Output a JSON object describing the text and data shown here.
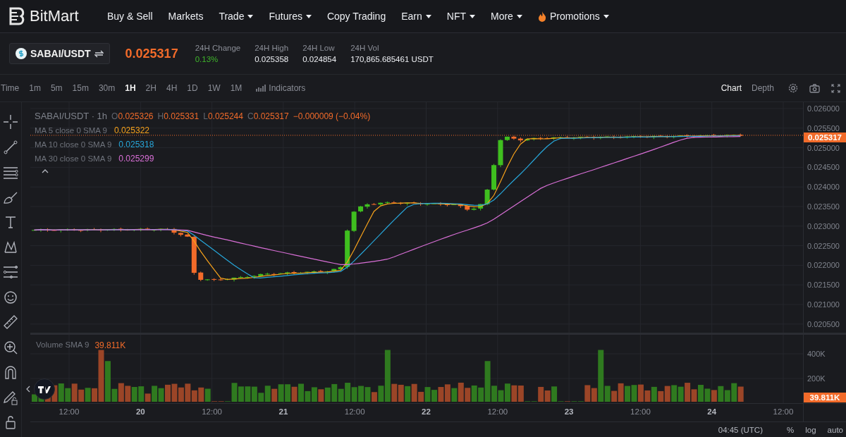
{
  "nav": {
    "brand": "BitMart",
    "items": [
      {
        "label": "Buy & Sell",
        "has_menu": false,
        "kind": "link"
      },
      {
        "label": "Markets",
        "has_menu": false,
        "kind": "link"
      },
      {
        "label": "Trade",
        "has_menu": true,
        "kind": "link"
      },
      {
        "label": "Futures",
        "has_menu": true,
        "kind": "link"
      },
      {
        "label": "Copy Trading",
        "has_menu": false,
        "kind": "link"
      },
      {
        "label": "Earn",
        "has_menu": true,
        "kind": "link"
      },
      {
        "label": "NFT",
        "has_menu": true,
        "kind": "link"
      },
      {
        "label": "More",
        "has_menu": true,
        "kind": "link"
      },
      {
        "label": "Promotions",
        "has_menu": true,
        "kind": "promo"
      }
    ]
  },
  "ticker": {
    "pair": "SABAI/USDT",
    "price": "0.025317",
    "stats": [
      {
        "label": "24H Change",
        "value": "0.13%",
        "kind": "up"
      },
      {
        "label": "24H High",
        "value": "0.025358",
        "kind": "plain"
      },
      {
        "label": "24H Low",
        "value": "0.024854",
        "kind": "plain"
      },
      {
        "label": "24H Vol",
        "value": "170,865.685461 USDT",
        "kind": "plain"
      }
    ]
  },
  "toolbar": {
    "intervals": [
      {
        "label": "Time",
        "selected": false
      },
      {
        "label": "1m",
        "selected": false
      },
      {
        "label": "5m",
        "selected": false
      },
      {
        "label": "15m",
        "selected": false
      },
      {
        "label": "30m",
        "selected": false
      },
      {
        "label": "1H",
        "selected": true
      },
      {
        "label": "2H",
        "selected": false
      },
      {
        "label": "4H",
        "selected": false
      },
      {
        "label": "1D",
        "selected": false
      },
      {
        "label": "1W",
        "selected": false
      },
      {
        "label": "1M",
        "selected": false
      }
    ],
    "indicators": "Indicators",
    "views": [
      {
        "label": "Chart",
        "selected": true
      },
      {
        "label": "Depth",
        "selected": false
      }
    ]
  },
  "legend": {
    "title": "SABAI/USDT · 1h",
    "ohlc": [
      {
        "label": "O",
        "value": "0.025326"
      },
      {
        "label": "H",
        "value": "0.025331"
      },
      {
        "label": "L",
        "value": "0.025244"
      },
      {
        "label": "C",
        "value": "0.025317"
      }
    ],
    "change": "−0.000009 (−0.04%)",
    "moving_averages": [
      {
        "label": "MA 5 close 0 SMA 9",
        "value": "0.025322",
        "color": "#f7a21b"
      },
      {
        "label": "MA 10 close 0 SMA 9",
        "value": "0.025318",
        "color": "#27a6d9"
      },
      {
        "label": "MA 30 close 0 SMA 9",
        "value": "0.025299",
        "color": "#d86fd6"
      }
    ]
  },
  "price_axis": [
    "0.026000",
    "0.025500",
    "0.025000",
    "0.024500",
    "0.024000",
    "0.023500",
    "0.023000",
    "0.022500",
    "0.022000",
    "0.021500",
    "0.021000",
    "0.020500"
  ],
  "last_price_tag": "0.025317",
  "volume": {
    "legend": "Volume SMA 9",
    "value": "39.811K",
    "axis": [
      "400K",
      "200K"
    ],
    "tag": "39.811K"
  },
  "time_axis": [
    {
      "label": "12:00",
      "kind": "time"
    },
    {
      "label": "20",
      "kind": "day"
    },
    {
      "label": "12:00",
      "kind": "time"
    },
    {
      "label": "21",
      "kind": "day"
    },
    {
      "label": "12:00",
      "kind": "time"
    },
    {
      "label": "22",
      "kind": "day"
    },
    {
      "label": "12:00",
      "kind": "time"
    },
    {
      "label": "23",
      "kind": "day"
    },
    {
      "label": "12:00",
      "kind": "time"
    },
    {
      "label": "24",
      "kind": "day"
    },
    {
      "label": "12:00",
      "kind": "time"
    }
  ],
  "footer": {
    "time": "04:45 (UTC)",
    "options": [
      "%",
      "log",
      "auto"
    ]
  }
}
